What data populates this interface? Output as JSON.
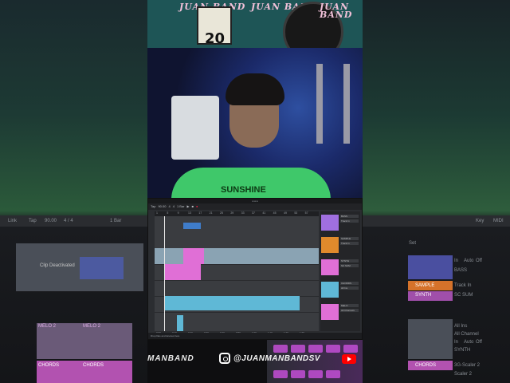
{
  "colors": {
    "clip_blue": "#3f7cc9",
    "clip_pink": "#e06fd6",
    "clip_cyan": "#5fb8d6",
    "selection": "#8aa3b3",
    "mixer_orange": "#e08a2c",
    "mixer_purple": "#a06fe0"
  },
  "poster": {
    "logo_text": "JUAN BAND",
    "date_number": "20"
  },
  "webcam": {
    "shirt_print": "SUNSHINE"
  },
  "daw": {
    "transport": {
      "tap": "Tap",
      "tempo": "90.00",
      "time_sig_num": "4",
      "time_sig_den": "4",
      "quantize": "1 Bar"
    },
    "ruler_marks": [
      "1",
      "5",
      "9",
      "13",
      "17",
      "21",
      "25",
      "29",
      "33",
      "37",
      "41",
      "45",
      "49",
      "53",
      "57"
    ],
    "bottom_ruler": [
      "0:00",
      "0:10",
      "0:20",
      "0:30",
      "0:40",
      "0:50",
      "1:00",
      "1:10",
      "1:20",
      "1:30"
    ],
    "mixer_tracks": [
      {
        "name": "BASS",
        "input": "Track In"
      },
      {
        "name": "SAMPLE",
        "input": "Track In"
      },
      {
        "name": "SYNTH",
        "input": "SC SUM"
      },
      {
        "name": "CHORDS",
        "input": "All Ins"
      },
      {
        "name": "MELO",
        "input": "All Channels"
      }
    ],
    "left_side_labels": [
      "Link",
      "Tap",
      "90.00",
      "4 / 4",
      "1 Bar",
      "Clip Deactivated",
      "MELO 2",
      "MELO 2",
      "CHORDS",
      "CHORDS"
    ],
    "right_side_labels": [
      "Key",
      "MIDI",
      "Set",
      "In",
      "Auto",
      "Off",
      "BASS",
      "SAMPLE",
      "Track In",
      "SYNTH",
      "SC SUM",
      "All Ins",
      "All Channel",
      "In",
      "Auto",
      "Off",
      "SYNTH",
      "CHORDS",
      "3G-Scaler 2",
      "Scaler 2"
    ],
    "status": "Drop files and devices here"
  },
  "social": {
    "left_handle": "MANBAND",
    "instagram_handle": "@JUANMANBANDSV",
    "icons": [
      "instagram-icon",
      "youtube-icon"
    ]
  }
}
